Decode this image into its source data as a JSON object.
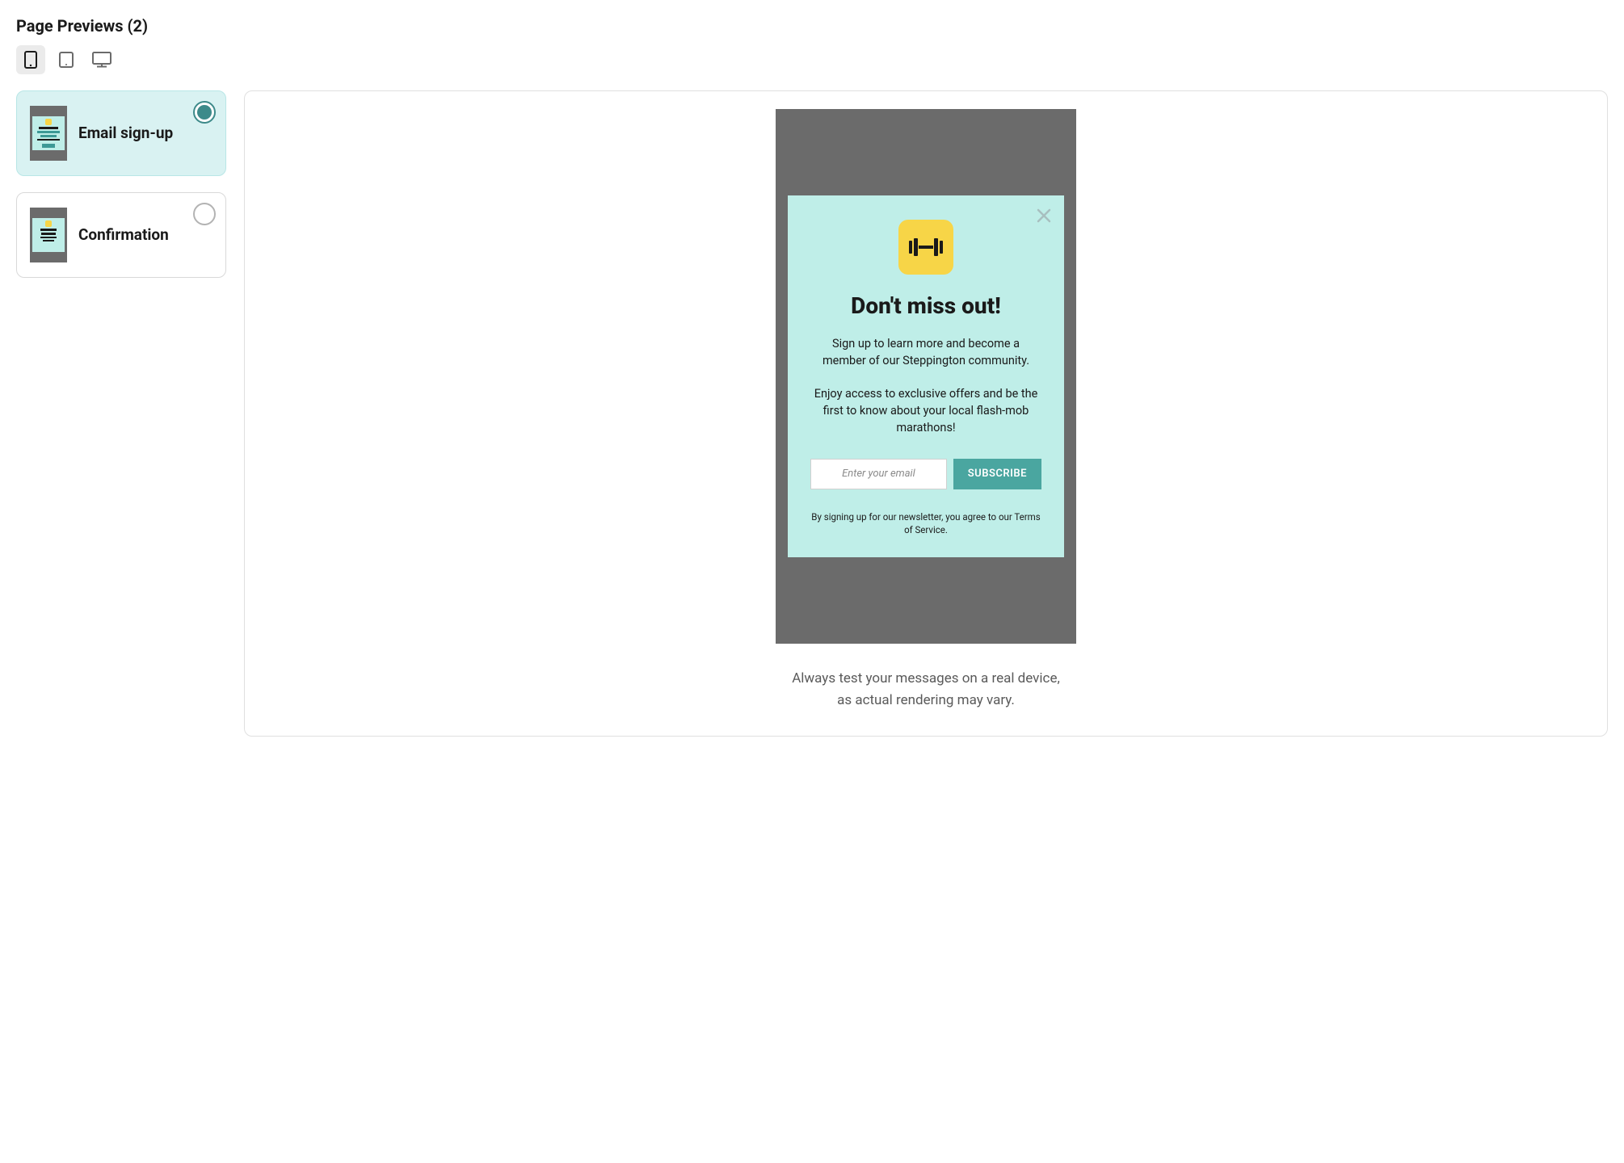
{
  "header": {
    "title": "Page Previews (2)"
  },
  "pages": [
    {
      "label": "Email sign-up",
      "selected": true
    },
    {
      "label": "Confirmation",
      "selected": false
    }
  ],
  "popup": {
    "heading": "Don't miss out!",
    "paragraph1": "Sign up to learn more and become a member of our Steppington community.",
    "paragraph2": "Enjoy access to exclusive offers and be the first to know about your local flash-mob marathons!",
    "email_placeholder": "Enter your email",
    "subscribe_label": "SUBSCRIBE",
    "disclaimer": "By signing up for our newsletter, you agree to our Terms of Service."
  },
  "footer": {
    "note_line1": "Always test your messages on a real device,",
    "note_line2": "as actual rendering may vary."
  }
}
